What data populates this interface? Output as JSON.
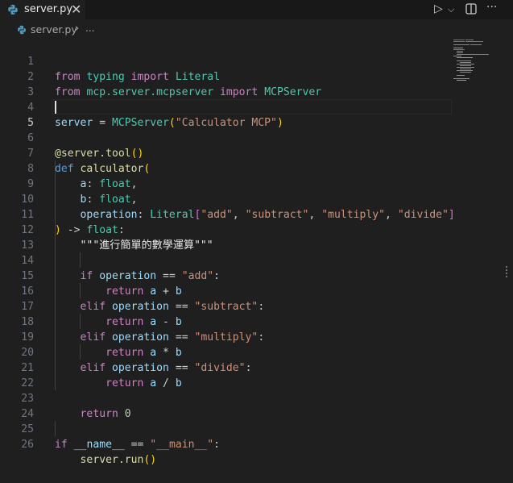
{
  "tab": {
    "filename": "server.py",
    "close": "✕"
  },
  "toolbar": {
    "run": "▷",
    "run_dropdown": "⌵",
    "split": "◫",
    "more": "···"
  },
  "breadcrumb": {
    "file": "server.py",
    "sep": "›",
    "more": "..."
  },
  "line_numbers": [
    "1",
    "2",
    "3",
    "4",
    "5",
    "6",
    "7",
    "8",
    "9",
    "10",
    "11",
    "12",
    "13",
    "14",
    "15",
    "16",
    "17",
    "18",
    "19",
    "20",
    "21",
    "22",
    "23",
    "24",
    "25",
    "26"
  ],
  "active_line": "5",
  "code": {
    "l1": [
      "from",
      "typing",
      "import",
      "Literal"
    ],
    "l2": [
      "from",
      "mcp.server.mcpserver",
      "import",
      "MCPServer"
    ],
    "l4": [
      "server",
      " = ",
      "MCPServer",
      "(",
      "\"Calculator MCP\"",
      ")"
    ],
    "l6": [
      "@server.tool",
      "()"
    ],
    "l7": [
      "def",
      "calculator",
      "("
    ],
    "l8": [
      "a",
      ": ",
      "float",
      ","
    ],
    "l9": [
      "b",
      ": ",
      "float",
      ","
    ],
    "l10": [
      "operation",
      ": ",
      "Literal",
      "[",
      "\"add\"",
      ", ",
      "\"subtract\"",
      ", ",
      "\"multiply\"",
      ", ",
      "\"divide\"",
      "]"
    ],
    "l11": [
      ")",
      " -> ",
      "float",
      ":"
    ],
    "l12": [
      "\"\"\"進行簡單的數學運算\"\"\""
    ],
    "l14": [
      "if",
      "operation",
      " == ",
      "\"add\"",
      ":"
    ],
    "l15": [
      "return",
      "a",
      " + ",
      "b"
    ],
    "l16": [
      "elif",
      "operation",
      " == ",
      "\"subtract\"",
      ":"
    ],
    "l17": [
      "return",
      "a",
      " - ",
      "b"
    ],
    "l18": [
      "elif",
      "operation",
      " == ",
      "\"multiply\"",
      ":"
    ],
    "l19": [
      "return",
      "a",
      " * ",
      "b"
    ],
    "l20": [
      "elif",
      "operation",
      " == ",
      "\"divide\"",
      ":"
    ],
    "l21": [
      "return",
      "a",
      " / ",
      "b"
    ],
    "l23": [
      "return",
      "0"
    ],
    "l25": [
      "if",
      "__name__",
      " == ",
      "\"__main__\"",
      ":"
    ],
    "l26": [
      "server.run",
      "()"
    ]
  },
  "colors": {
    "keyword": "#569cd6",
    "control": "#c586c0",
    "function": "#dcdcaa",
    "string": "#ce9178",
    "number": "#b5cea8",
    "type": "#4ec9b0",
    "variable": "#9cdcfe",
    "paren": "#ffd700"
  }
}
